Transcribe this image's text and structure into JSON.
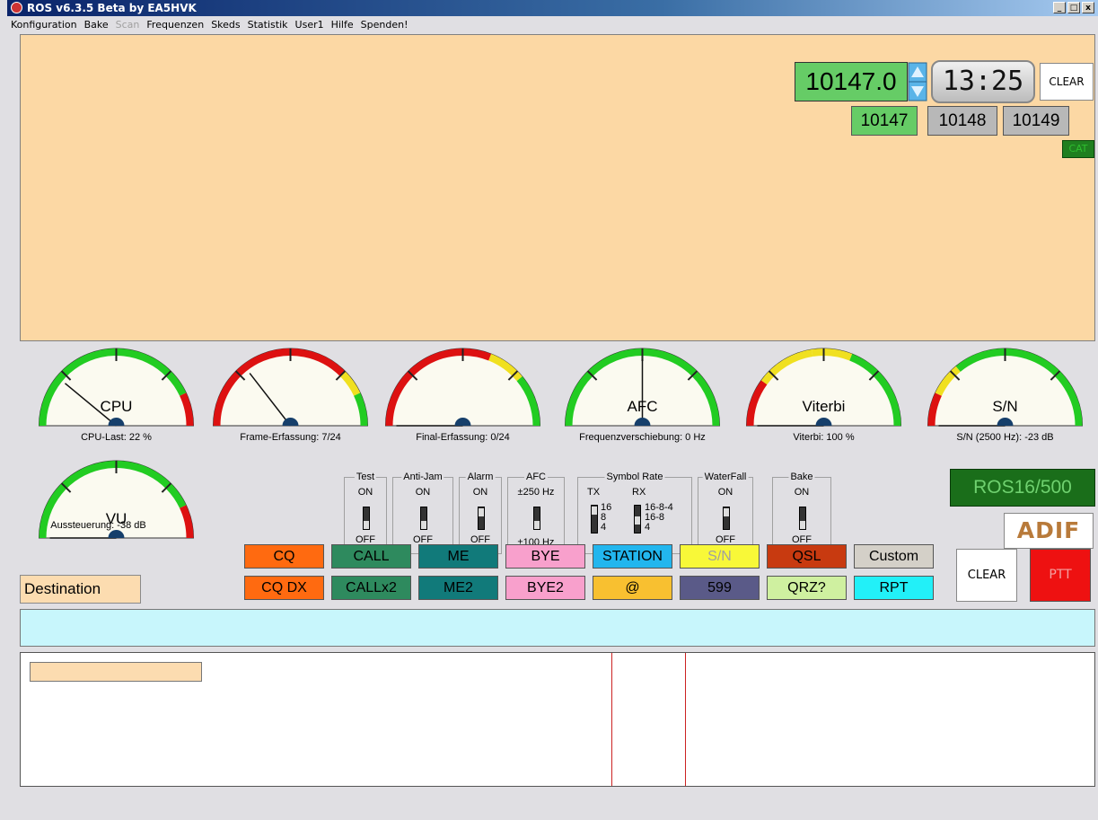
{
  "window": {
    "title": "ROS v6.3.5 Beta by EA5HVK",
    "buttons": [
      "_",
      "□",
      "x"
    ]
  },
  "menu": [
    "Konfiguration",
    "Bake",
    "Scan",
    "Frequenzen",
    "Skeds",
    "Statistik",
    "User1",
    "Hilfe",
    "Spenden!"
  ],
  "menu_disabled": [
    "Scan"
  ],
  "rx": {
    "frequency": "10147.0",
    "clock": "13:25",
    "clear_label": "CLEAR",
    "freq_buttons": [
      "10147",
      "10148",
      "10149"
    ],
    "cat_label": "CAT"
  },
  "gauges": [
    {
      "name": "CPU",
      "caption": "CPU-Last: 22 %",
      "value": 0.22
    },
    {
      "name": "",
      "caption": "Frame-Erfassung: 7/24",
      "value": 0.29
    },
    {
      "name": "",
      "caption": "Final-Erfassung: 0/24",
      "value": 0.0
    },
    {
      "name": "AFC",
      "caption": "Frequenzverschiebung: 0 Hz",
      "value": 0.5
    },
    {
      "name": "Viterbi",
      "caption": "Viterbi: 100 %",
      "value": 0.0
    },
    {
      "name": "S/N",
      "caption": "S/N (2500 Hz): -23 dB",
      "value": 0.0
    },
    {
      "name": "VU",
      "caption": "Aussteuerung: -38 dB",
      "value": 0.0
    }
  ],
  "switches": {
    "test": {
      "title": "Test",
      "on": "ON",
      "off": "OFF"
    },
    "antijam": {
      "title": "Anti-Jam",
      "on": "ON",
      "off": "OFF"
    },
    "alarm": {
      "title": "Alarm",
      "on": "ON",
      "off": "OFF"
    },
    "afc": {
      "title": "AFC",
      "on": "±250 Hz",
      "off": "±100 Hz"
    },
    "symbol": {
      "title": "Symbol Rate",
      "tx": "TX",
      "rx": "RX",
      "tx_values": [
        "16",
        "8",
        "4"
      ],
      "rx_values": [
        "16-8-4",
        "16-8",
        "4"
      ]
    },
    "waterfall": {
      "title": "WaterFall",
      "on": "ON",
      "off": "OFF"
    },
    "bake": {
      "title": "Bake",
      "on": "ON",
      "off": "OFF"
    }
  },
  "mode": "ROS16/500",
  "adif": "ADIF",
  "macros": {
    "row1": [
      "CQ",
      "CALL",
      "ME",
      "BYE",
      "STATION",
      "S/N",
      "QSL",
      "Custom"
    ],
    "row2": [
      "CQ DX",
      "CALLx2",
      "ME2",
      "BYE2",
      "@",
      "599",
      "QRZ?",
      "RPT"
    ]
  },
  "destination": "Destination",
  "clear_label": "CLEAR",
  "ptt_label": "PTT"
}
